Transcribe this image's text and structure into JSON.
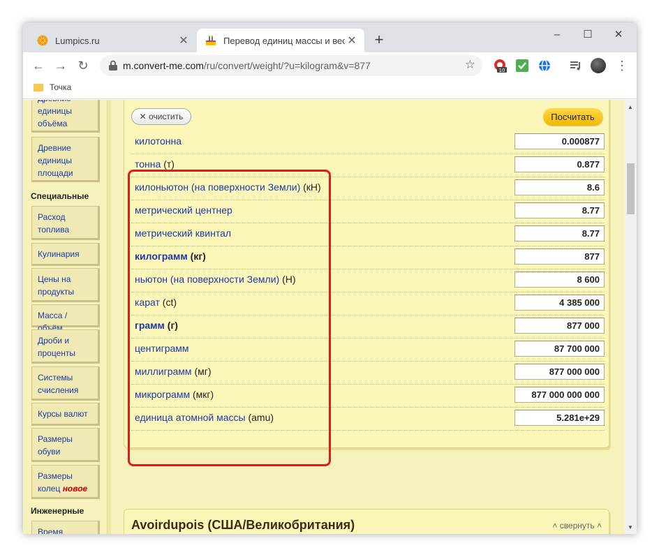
{
  "browser": {
    "tabs": [
      {
        "title": "Lumpics.ru",
        "active": false
      },
      {
        "title": "Перевод единиц массы и веса",
        "active": true
      }
    ],
    "new_tab_symbol": "+",
    "window_controls": [
      "–",
      "☐",
      "✕"
    ],
    "url_host": "m.convert-me.com",
    "url_path": "/ru/convert/weight/?u=kilogram&v=877",
    "extension_badge": "10",
    "bookmark": "Точка"
  },
  "sidebar": {
    "top_items": [
      {
        "label": "Древние единицы объёма"
      },
      {
        "label": "Древние единицы площади"
      }
    ],
    "section_special": "Специальные",
    "special_items": [
      {
        "label": "Расход топлива"
      },
      {
        "label": "Кулинария"
      },
      {
        "label": "Цены на продукты"
      },
      {
        "label": "Масса / объём"
      },
      {
        "label": "Дроби и проценты"
      },
      {
        "label": "Системы счисления"
      },
      {
        "label": "Курсы валют"
      },
      {
        "label": "Размеры обуви"
      },
      {
        "label": "Размеры колец",
        "badge": "новое"
      }
    ],
    "section_engineering": "Инженерные",
    "engineering_items": [
      {
        "label": "Время"
      }
    ]
  },
  "converter": {
    "clear_label": "очистить",
    "calc_label": "Посчитать",
    "rows": [
      {
        "name": "килотонна",
        "unit": "",
        "value": "0.000877",
        "bold": false
      },
      {
        "name": "тонна",
        "unit": "(т)",
        "value": "0.877",
        "bold": false
      },
      {
        "name": "килоньютон (на поверхности Земли)",
        "unit": "(кН)",
        "value": "8.6",
        "bold": false
      },
      {
        "name": "метрический центнер",
        "unit": "",
        "value": "8.77",
        "bold": false
      },
      {
        "name": "метрический квинтал",
        "unit": "",
        "value": "8.77",
        "bold": false
      },
      {
        "name": "килограмм",
        "unit": "(кг)",
        "value": "877",
        "bold": true
      },
      {
        "name": "ньютон (на поверхности Земли)",
        "unit": "(Н)",
        "value": "8 600",
        "bold": false
      },
      {
        "name": "карат",
        "unit": "(ct)",
        "value": "4 385 000",
        "bold": false
      },
      {
        "name": "грамм",
        "unit": "(г)",
        "value": "877 000",
        "bold": true
      },
      {
        "name": "центиграмм",
        "unit": "",
        "value": "87 700 000",
        "bold": false
      },
      {
        "name": "миллиграмм",
        "unit": "(мг)",
        "value": "877 000 000",
        "bold": false
      },
      {
        "name": "микрограмм",
        "unit": "(мкг)",
        "value": "877 000 000 000",
        "bold": false
      },
      {
        "name": "единица атомной массы",
        "unit": "(amu)",
        "value": "5.281e+29",
        "bold": false
      }
    ]
  },
  "section2": {
    "title": "Avoirdupois (США/Великобритания)",
    "collapse_label": "свернуть"
  },
  "colors": {
    "page_bg": "#f7f1bc",
    "link": "#1a3aa7",
    "highlight": "#e11b1b",
    "calc_button": "#f3b800"
  }
}
